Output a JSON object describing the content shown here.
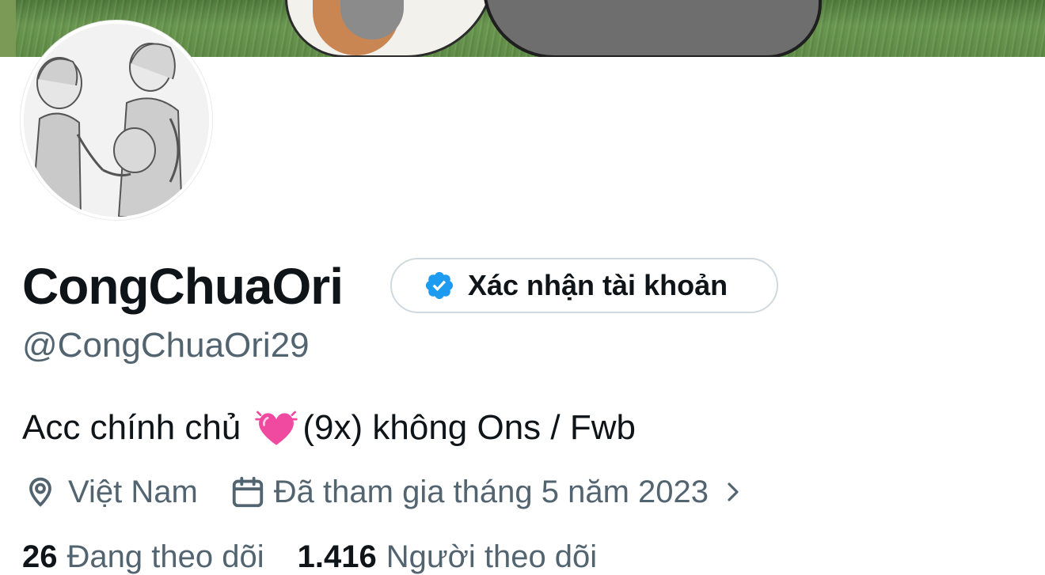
{
  "profile": {
    "display_name": "CongChuaOri",
    "handle": "@CongChuaOri29",
    "verify_button_label": "Xác nhận tài khoản",
    "bio_text": "Acc chính chủ",
    "bio_emoji": "💓",
    "bio_text_after": "(9x) không Ons / Fwb",
    "location": "Việt Nam",
    "joined": "Đã tham gia tháng 5 năm 2023",
    "following_count": "26",
    "following_label": "Đang theo dõi",
    "followers_count": "1.416",
    "followers_label": "Người theo dõi"
  },
  "icons": {
    "verified": "verified-badge-icon",
    "location": "location-pin-icon",
    "calendar": "calendar-icon",
    "chevron": "chevron-right-icon"
  },
  "colors": {
    "text_primary": "#0f1419",
    "text_secondary": "#536471",
    "verified_blue": "#1d9bf0",
    "border": "#cfd9de"
  }
}
